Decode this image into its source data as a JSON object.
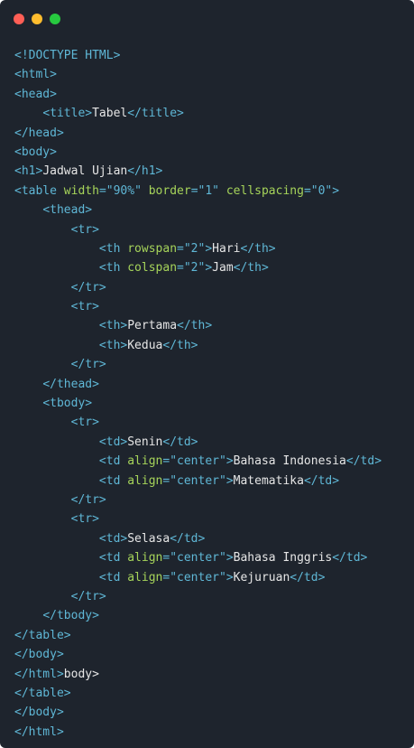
{
  "window": {
    "controls": [
      {
        "name": "close",
        "color": "#ff5f56"
      },
      {
        "name": "minimize",
        "color": "#ffbd2e"
      },
      {
        "name": "maximize",
        "color": "#27c93f"
      }
    ]
  },
  "editor": {
    "lines": [
      {
        "indent": "",
        "tokens": [
          {
            "t": "tag",
            "v": "<!DOCTYPE HTML>"
          }
        ]
      },
      {
        "indent": "",
        "tokens": [
          {
            "t": "tag",
            "v": "<html>"
          }
        ]
      },
      {
        "indent": "",
        "tokens": [
          {
            "t": "tag",
            "v": "<head>"
          }
        ]
      },
      {
        "indent": "    ",
        "tokens": [
          {
            "t": "tag",
            "v": "<title>"
          },
          {
            "t": "text",
            "v": "Tabel"
          },
          {
            "t": "tag",
            "v": "</title>"
          }
        ]
      },
      {
        "indent": "",
        "tokens": [
          {
            "t": "tag",
            "v": "</head>"
          }
        ]
      },
      {
        "indent": "",
        "tokens": [
          {
            "t": "tag",
            "v": "<body>"
          }
        ]
      },
      {
        "indent": "",
        "tokens": [
          {
            "t": "tag",
            "v": "<h1>"
          },
          {
            "t": "text",
            "v": "Jadwal Ujian"
          },
          {
            "t": "tag",
            "v": "</h1>"
          }
        ]
      },
      {
        "indent": "",
        "tokens": [
          {
            "t": "tag",
            "v": "<table "
          },
          {
            "t": "attr",
            "v": "width"
          },
          {
            "t": "tag",
            "v": "="
          },
          {
            "t": "str",
            "v": "\"90%\""
          },
          {
            "t": "tag",
            "v": " "
          },
          {
            "t": "attr",
            "v": "border"
          },
          {
            "t": "tag",
            "v": "="
          },
          {
            "t": "str",
            "v": "\"1\""
          },
          {
            "t": "tag",
            "v": " "
          },
          {
            "t": "attr",
            "v": "cellspacing"
          },
          {
            "t": "tag",
            "v": "="
          },
          {
            "t": "str",
            "v": "\"0\""
          },
          {
            "t": "tag",
            "v": ">"
          }
        ]
      },
      {
        "indent": "    ",
        "tokens": [
          {
            "t": "tag",
            "v": "<thead>"
          }
        ]
      },
      {
        "indent": "        ",
        "tokens": [
          {
            "t": "tag",
            "v": "<tr>"
          }
        ]
      },
      {
        "indent": "            ",
        "tokens": [
          {
            "t": "tag",
            "v": "<th "
          },
          {
            "t": "attr",
            "v": "rowspan"
          },
          {
            "t": "tag",
            "v": "="
          },
          {
            "t": "str",
            "v": "\"2\""
          },
          {
            "t": "tag",
            "v": ">"
          },
          {
            "t": "text",
            "v": "Hari"
          },
          {
            "t": "tag",
            "v": "</th>"
          }
        ]
      },
      {
        "indent": "            ",
        "tokens": [
          {
            "t": "tag",
            "v": "<th "
          },
          {
            "t": "attr",
            "v": "colspan"
          },
          {
            "t": "tag",
            "v": "="
          },
          {
            "t": "str",
            "v": "\"2\""
          },
          {
            "t": "tag",
            "v": ">"
          },
          {
            "t": "text",
            "v": "Jam"
          },
          {
            "t": "tag",
            "v": "</th>"
          }
        ]
      },
      {
        "indent": "        ",
        "tokens": [
          {
            "t": "tag",
            "v": "</tr>"
          }
        ]
      },
      {
        "indent": "        ",
        "tokens": [
          {
            "t": "tag",
            "v": "<tr>"
          }
        ]
      },
      {
        "indent": "            ",
        "tokens": [
          {
            "t": "tag",
            "v": "<th>"
          },
          {
            "t": "text",
            "v": "Pertama"
          },
          {
            "t": "tag",
            "v": "</th>"
          }
        ]
      },
      {
        "indent": "            ",
        "tokens": [
          {
            "t": "tag",
            "v": "<th>"
          },
          {
            "t": "text",
            "v": "Kedua"
          },
          {
            "t": "tag",
            "v": "</th>"
          }
        ]
      },
      {
        "indent": "        ",
        "tokens": [
          {
            "t": "tag",
            "v": "</tr>"
          }
        ]
      },
      {
        "indent": "    ",
        "tokens": [
          {
            "t": "tag",
            "v": "</thead>"
          }
        ]
      },
      {
        "indent": "    ",
        "tokens": [
          {
            "t": "tag",
            "v": "<tbody>"
          }
        ]
      },
      {
        "indent": "        ",
        "tokens": [
          {
            "t": "tag",
            "v": "<tr>"
          }
        ]
      },
      {
        "indent": "            ",
        "tokens": [
          {
            "t": "tag",
            "v": "<td>"
          },
          {
            "t": "text",
            "v": "Senin"
          },
          {
            "t": "tag",
            "v": "</td>"
          }
        ]
      },
      {
        "indent": "            ",
        "tokens": [
          {
            "t": "tag",
            "v": "<td "
          },
          {
            "t": "attr",
            "v": "align"
          },
          {
            "t": "tag",
            "v": "="
          },
          {
            "t": "str",
            "v": "\"center\""
          },
          {
            "t": "tag",
            "v": ">"
          },
          {
            "t": "text",
            "v": "Bahasa Indonesia"
          },
          {
            "t": "tag",
            "v": "</td>"
          }
        ]
      },
      {
        "indent": "            ",
        "tokens": [
          {
            "t": "tag",
            "v": "<td "
          },
          {
            "t": "attr",
            "v": "align"
          },
          {
            "t": "tag",
            "v": "="
          },
          {
            "t": "str",
            "v": "\"center\""
          },
          {
            "t": "tag",
            "v": ">"
          },
          {
            "t": "text",
            "v": "Matematika"
          },
          {
            "t": "tag",
            "v": "</td>"
          }
        ]
      },
      {
        "indent": "        ",
        "tokens": [
          {
            "t": "tag",
            "v": "</tr>"
          }
        ]
      },
      {
        "indent": "        ",
        "tokens": [
          {
            "t": "tag",
            "v": "<tr>"
          }
        ]
      },
      {
        "indent": "            ",
        "tokens": [
          {
            "t": "tag",
            "v": "<td>"
          },
          {
            "t": "text",
            "v": "Selasa"
          },
          {
            "t": "tag",
            "v": "</td>"
          }
        ]
      },
      {
        "indent": "            ",
        "tokens": [
          {
            "t": "tag",
            "v": "<td "
          },
          {
            "t": "attr",
            "v": "align"
          },
          {
            "t": "tag",
            "v": "="
          },
          {
            "t": "str",
            "v": "\"center\""
          },
          {
            "t": "tag",
            "v": ">"
          },
          {
            "t": "text",
            "v": "Bahasa Inggris"
          },
          {
            "t": "tag",
            "v": "</td>"
          }
        ]
      },
      {
        "indent": "            ",
        "tokens": [
          {
            "t": "tag",
            "v": "<td "
          },
          {
            "t": "attr",
            "v": "align"
          },
          {
            "t": "tag",
            "v": "="
          },
          {
            "t": "str",
            "v": "\"center\""
          },
          {
            "t": "tag",
            "v": ">"
          },
          {
            "t": "text",
            "v": "Kejuruan"
          },
          {
            "t": "tag",
            "v": "</td>"
          }
        ]
      },
      {
        "indent": "        ",
        "tokens": [
          {
            "t": "tag",
            "v": "</tr>"
          }
        ]
      },
      {
        "indent": "    ",
        "tokens": [
          {
            "t": "tag",
            "v": "</tbody>"
          }
        ]
      },
      {
        "indent": "",
        "tokens": [
          {
            "t": "tag",
            "v": "</table>"
          }
        ]
      },
      {
        "indent": "",
        "tokens": [
          {
            "t": "tag",
            "v": "</body>"
          }
        ]
      },
      {
        "indent": "",
        "tokens": [
          {
            "t": "tag",
            "v": "</html>"
          },
          {
            "t": "text",
            "v": "body>"
          }
        ]
      },
      {
        "indent": "",
        "tokens": [
          {
            "t": "tag",
            "v": "</table>"
          }
        ]
      },
      {
        "indent": "",
        "tokens": [
          {
            "t": "tag",
            "v": "</body>"
          }
        ]
      },
      {
        "indent": "",
        "tokens": [
          {
            "t": "tag",
            "v": "</html>"
          }
        ]
      }
    ]
  }
}
